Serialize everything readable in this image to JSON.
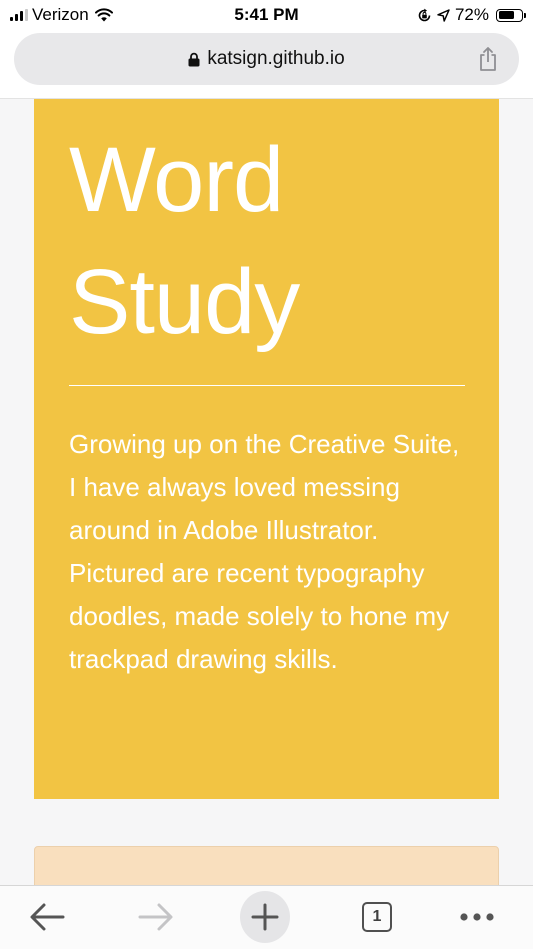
{
  "status_bar": {
    "carrier": "Verizon",
    "time": "5:41 PM",
    "battery_percent": "72%",
    "battery_level": 0.72,
    "icons": [
      "signal-icon",
      "wifi-icon",
      "orientation-lock-icon",
      "location-icon",
      "battery-icon"
    ]
  },
  "browser": {
    "url": "katsign.github.io",
    "icons": [
      "lock-icon",
      "share-icon"
    ]
  },
  "hero": {
    "title_line1": "Word",
    "title_line2": "Study",
    "description": "Growing up on the Creative Suite, I have always loved messing around in Adobe Illustrator. Pictured are recent typography doodles, made solely to hone my trackpad drawing skills.",
    "background_color": "#f2c443"
  },
  "next_card": {
    "background_color": "#f9dfbe"
  },
  "toolbar": {
    "tab_count": "1",
    "icons": [
      "back-arrow-icon",
      "forward-arrow-icon",
      "new-tab-icon",
      "tabs-icon",
      "more-icon"
    ]
  }
}
